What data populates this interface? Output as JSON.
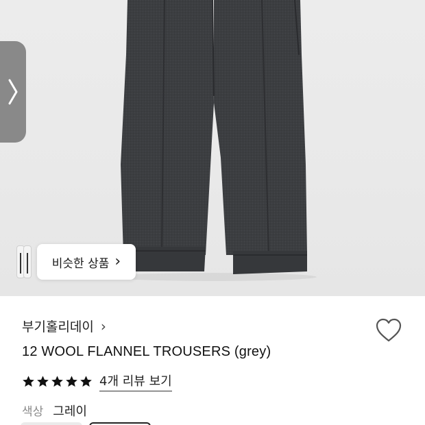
{
  "similar_products": {
    "label": "비슷한 상품",
    "chevron": "›"
  },
  "product": {
    "brand": "부기홀리데이",
    "brand_chevron": "›",
    "title": "12 WOOL FLANNEL TROUSERS (grey)",
    "rating": 5,
    "review_link": "4개 리뷰 보기",
    "color_label": "색상",
    "color_value": "그레이"
  },
  "icons": {
    "prev": "chevron-left-icon",
    "wishlist": "heart-outline-icon",
    "star": "star-filled-icon"
  },
  "colors": {
    "background": "#ffffff",
    "hero_bg": "#eaeaea",
    "trousers": "#3b3d40",
    "text": "#1a1a1a",
    "muted": "#8a8a8a"
  }
}
